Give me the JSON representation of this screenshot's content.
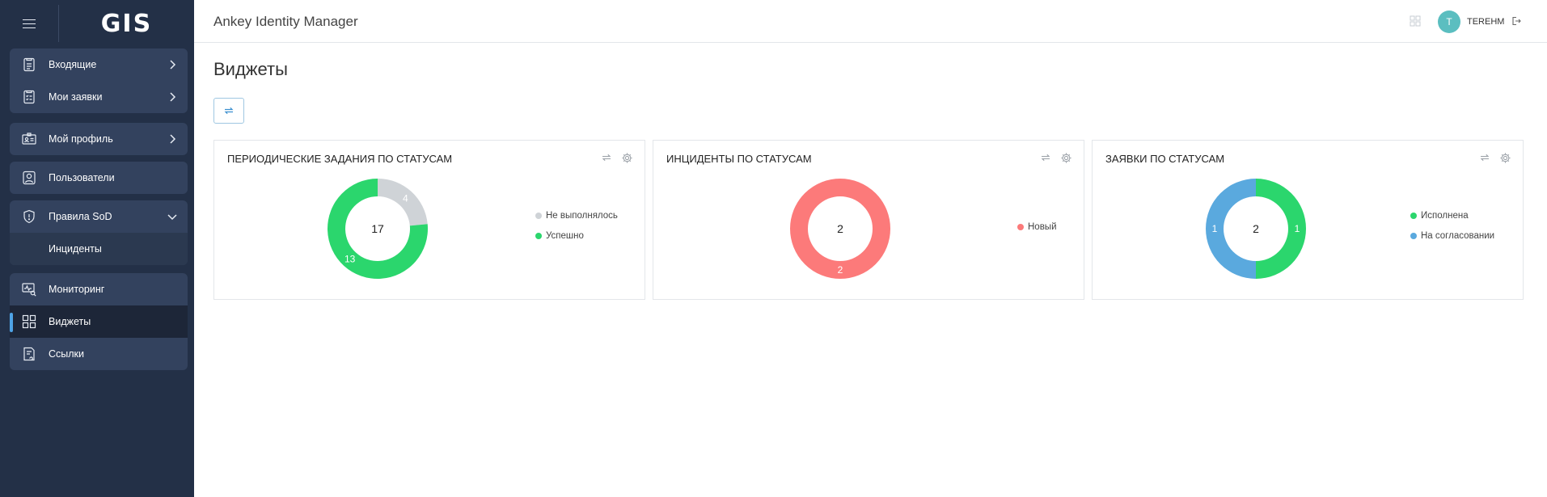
{
  "app": {
    "title": "Ankey Identity Manager",
    "logo": "GIS"
  },
  "header": {
    "user_initial": "T",
    "username": "TEREHM"
  },
  "sidebar": {
    "items": [
      {
        "label": "Входящие"
      },
      {
        "label": "Мои заявки"
      },
      {
        "label": "Мой профиль"
      },
      {
        "label": "Пользователи"
      },
      {
        "label": "Правила SoD"
      },
      {
        "label": "Инциденты"
      },
      {
        "label": "Мониторинг"
      },
      {
        "label": "Виджеты"
      },
      {
        "label": "Ссылки"
      }
    ]
  },
  "main": {
    "page_title": "Виджеты"
  },
  "widgets": [
    {
      "title": "ПЕРИОДИЧЕСКИЕ ЗАДАНИЯ ПО СТАТУСАМ",
      "total": "17",
      "segments": [
        {
          "label": "Не выполнялось",
          "value": 4,
          "color": "#cfd3d7"
        },
        {
          "label": "Успешно",
          "value": 13,
          "color": "#2bd66d"
        }
      ]
    },
    {
      "title": "ИНЦИДЕНТЫ ПО СТАТУСАМ",
      "total": "2",
      "segments": [
        {
          "label": "Новый",
          "value": 2,
          "color": "#fc7a7a"
        }
      ]
    },
    {
      "title": "ЗАЯВКИ ПО СТАТУСАМ",
      "total": "2",
      "segments": [
        {
          "label": "Исполнена",
          "value": 1,
          "color": "#2bd66d"
        },
        {
          "label": "На согласовании",
          "value": 1,
          "color": "#5aa9de"
        }
      ]
    }
  ],
  "icons": {
    "menu": "hamburger-icon",
    "inbox": "inbox-icon",
    "requests": "clipboard-list-icon",
    "profile": "id-card-icon",
    "users": "user-icon",
    "sod": "shield-icon",
    "monitoring": "monitor-search-icon",
    "widgets": "grid-icon",
    "links": "document-link-icon",
    "refresh": "refresh-icon",
    "settings": "gear-icon",
    "logout": "logout-icon"
  }
}
